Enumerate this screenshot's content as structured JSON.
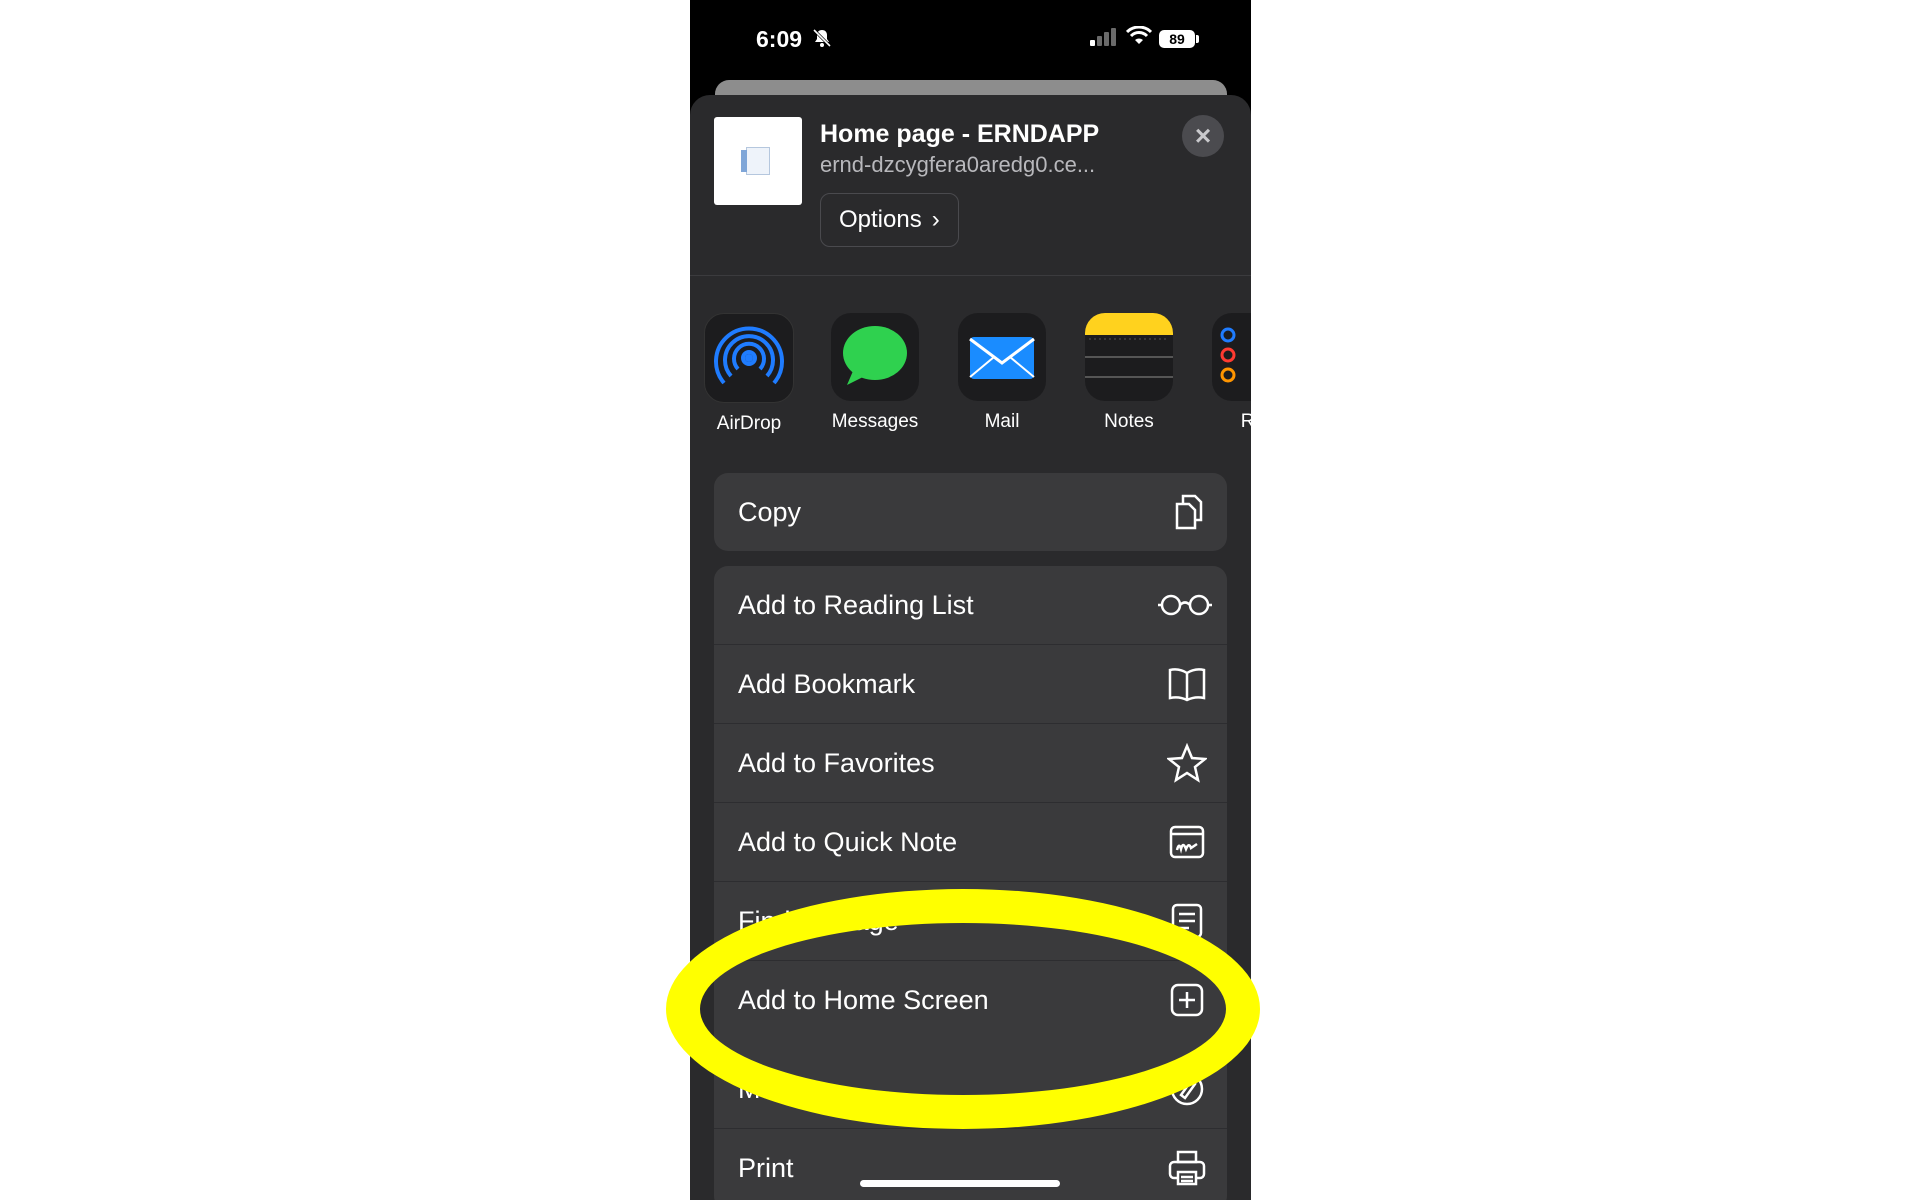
{
  "status_bar": {
    "time": "6:09",
    "battery": "89"
  },
  "share_sheet": {
    "page_title": "Home page - ERNDAPP",
    "page_url": "ernd-dzcygfera0aredg0.ce...",
    "options_label": "Options",
    "close_icon": "close-icon"
  },
  "apps": [
    {
      "label": "AirDrop",
      "icon": "airdrop-icon"
    },
    {
      "label": "Messages",
      "icon": "messages-icon"
    },
    {
      "label": "Mail",
      "icon": "mail-icon"
    },
    {
      "label": "Notes",
      "icon": "notes-icon"
    },
    {
      "label": "Rer",
      "icon": "reminders-icon"
    }
  ],
  "actions": {
    "copy": {
      "label": "Copy",
      "icon": "copy-icon"
    },
    "reading_list": {
      "label": "Add to Reading List",
      "icon": "glasses-icon"
    },
    "bookmark": {
      "label": "Add Bookmark",
      "icon": "book-icon"
    },
    "favorites": {
      "label": "Add to Favorites",
      "icon": "star-icon"
    },
    "quick_note": {
      "label": "Add to Quick Note",
      "icon": "quick-note-icon"
    },
    "find_on_page": {
      "label": "Find on Page",
      "icon": "find-icon"
    },
    "home_screen": {
      "label": "Add to Home Screen",
      "icon": "plus-square-icon"
    },
    "markup": {
      "label": "Markup",
      "icon": "markup-icon"
    },
    "print": {
      "label": "Print",
      "icon": "printer-icon"
    }
  },
  "highlight_color": "#ffff00"
}
